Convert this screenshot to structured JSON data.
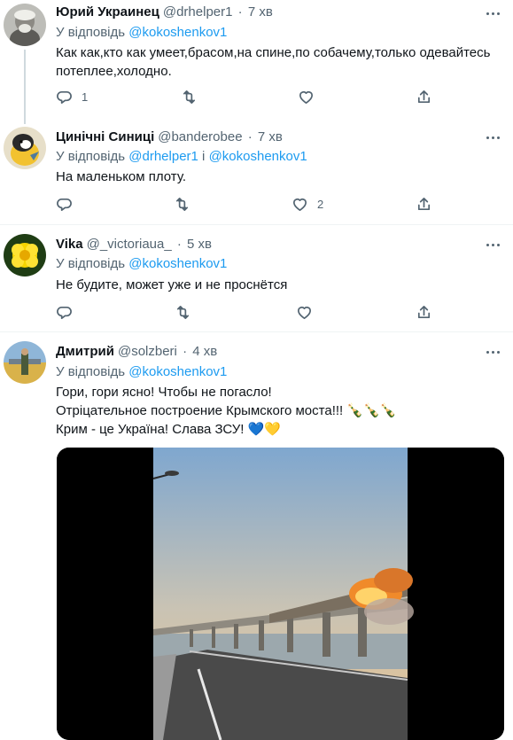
{
  "colors": {
    "accent": "#1d9bf0",
    "secondary_text": "#536471",
    "thread_line": "#cfd9de",
    "heart_blue": "#5aa7e8",
    "heart_yellow": "#f2c94c"
  },
  "tweets": [
    {
      "name": "Юрий Украинец",
      "handle": "@drhelper1",
      "time": "7 хв",
      "reply_prefix": "У відповідь",
      "reply_to": "@kokoshenkov1",
      "text": "Как как,кто как умеет,брасом,на спине,по собачему,только одевайтесь\nпотеплее,холодно.",
      "reply_count": "1",
      "retweet_count": "",
      "like_count": ""
    },
    {
      "name": "Цинічні Синиці",
      "handle": "@banderobee",
      "time": "7 хв",
      "reply_prefix": "У відповідь",
      "reply_to_1": "@drhelper1",
      "reply_joiner": "і",
      "reply_to_2": "@kokoshenkov1",
      "text": "На маленьком плоту.",
      "reply_count": "",
      "retweet_count": "",
      "like_count": "2"
    },
    {
      "name": "Vika",
      "handle": "@_victoriaua_",
      "time": "5 хв",
      "reply_prefix": "У відповідь",
      "reply_to": "@kokoshenkov1",
      "text": "Не будите, может уже и не проснётся",
      "reply_count": "",
      "retweet_count": "",
      "like_count": ""
    },
    {
      "name": "Дмитрий",
      "handle": "@solzberi",
      "time": "4 хв",
      "reply_prefix": "У відповідь",
      "reply_to": "@kokoshenkov1",
      "text_line1": "Гори, гори ясно! Чтобы не погасло!",
      "text_line2": "Отріцательное построение Крымского моста!!!",
      "text_line2_emoji": "🍾🍾🍾",
      "text_line3": "Крим - це Україна! Слава ЗСУ!",
      "text_line3_emoji": "💙💛"
    }
  ],
  "separator": "·"
}
